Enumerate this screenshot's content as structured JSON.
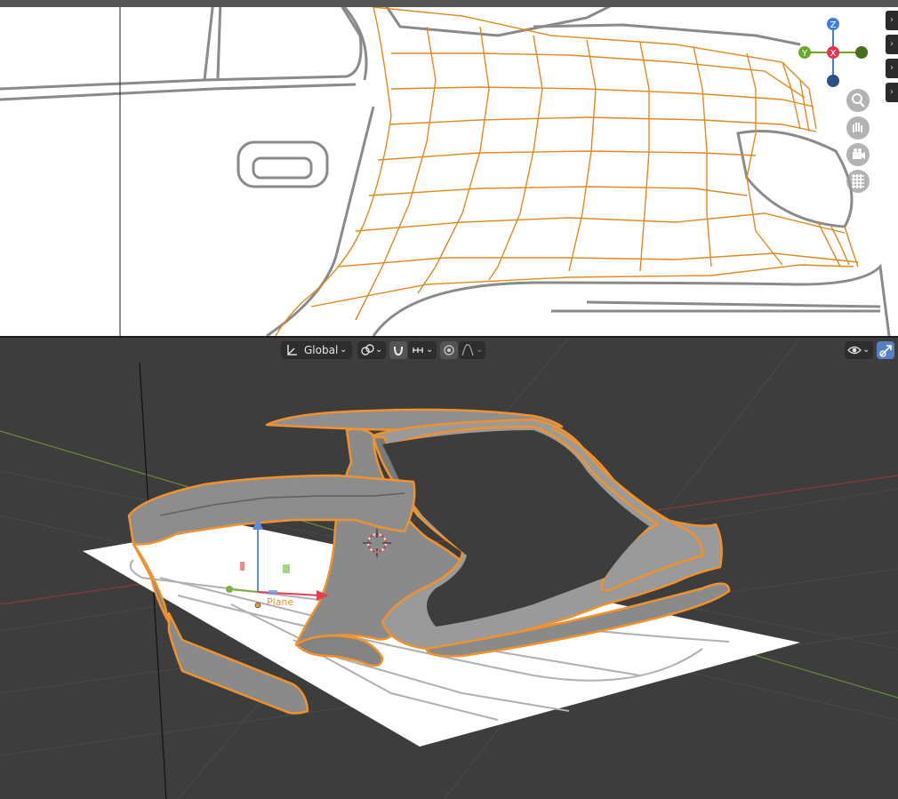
{
  "header": {
    "orientation_label": "Global",
    "orientation_icon": "transform-orientation-icon",
    "pivot_icon": "pivot-point-icon",
    "snap_icon": "snap-magnet-icon",
    "snap_increment_icon": "snap-increment-icon",
    "proportional_icon": "proportional-editing-icon",
    "falloff_icon": "falloff-curve-icon",
    "visibility_icon": "eye-icon",
    "gizmo_icon": "gizmo-toggle-icon"
  },
  "viewport_gizmo": {
    "z_label": "Z",
    "y_label": "Y",
    "x_label": "X",
    "x_color": "#e2354f",
    "y_color": "#6aa82a",
    "z_color": "#3f80d6"
  },
  "nav_buttons": {
    "zoom_icon": "zoom-icon",
    "pan_icon": "hand-pan-icon",
    "camera_icon": "camera-icon",
    "grid_icon": "ortho-grid-icon"
  },
  "side_tabs": [
    "›",
    "›",
    "›",
    "›"
  ],
  "scene": {
    "object_label": "Plane",
    "selection_color": "#f0922e"
  }
}
